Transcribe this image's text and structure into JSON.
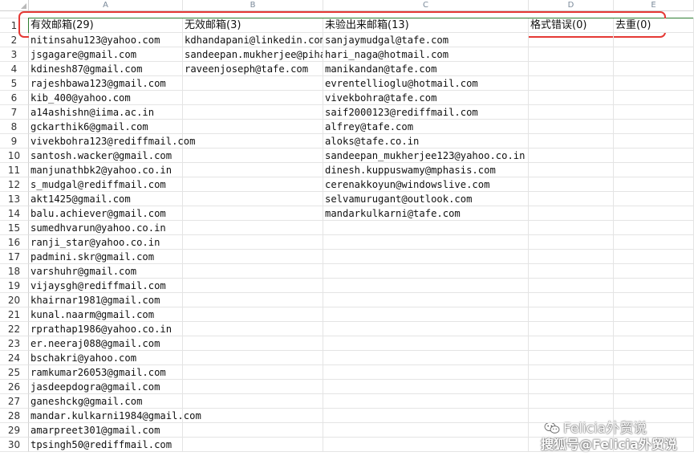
{
  "columns": [
    "A",
    "B",
    "C",
    "D",
    "E"
  ],
  "rows": [
    [
      "有效邮箱(29)",
      "无效邮箱(3)",
      "未验出来邮箱(13)",
      "格式错误(0)",
      "去重(0)"
    ],
    [
      "nitinsahu123@yahoo.com",
      "kdhandapani@linkedin.com",
      "sanjaymudgal@tafe.com",
      "",
      ""
    ],
    [
      "jsgagare@gmail.com",
      "sandeepan.mukherjee@pihari_naga@hotmail.com",
      "hari_naga@hotmail.com",
      "",
      ""
    ],
    [
      "kdinesh87@gmail.com",
      "raveenjoseph@tafe.com",
      "manikandan@tafe.com",
      "",
      ""
    ],
    [
      "rajeshbawa123@gmail.com",
      "",
      "evrentellioglu@hotmail.com",
      "",
      ""
    ],
    [
      "kib_400@yahoo.com",
      "",
      "vivekbohra@tafe.com",
      "",
      ""
    ],
    [
      "a14ashishn@iima.ac.in",
      "",
      "saif2000123@rediffmail.com",
      "",
      ""
    ],
    [
      "gckarthik6@gmail.com",
      "",
      "alfrey@tafe.com",
      "",
      ""
    ],
    [
      "vivekbohra123@rediffmail.com",
      "",
      "aloks@tafe.co.in",
      "",
      ""
    ],
    [
      "santosh.wacker@gmail.com",
      "",
      "sandeepan_mukherjee123@yahoo.co.in",
      "",
      ""
    ],
    [
      "manjunathbk2@yahoo.co.in",
      "",
      "dinesh.kuppuswamy@mphasis.com",
      "",
      ""
    ],
    [
      "s_mudgal@rediffmail.com",
      "",
      "cerenakkoyun@windowslive.com",
      "",
      ""
    ],
    [
      "akt1425@gmail.com",
      "",
      "selvamurugant@outlook.com",
      "",
      ""
    ],
    [
      "balu.achiever@gmail.com",
      "",
      "mandarkulkarni@tafe.com",
      "",
      ""
    ],
    [
      "sumedhvarun@yahoo.co.in",
      "",
      "",
      "",
      ""
    ],
    [
      "ranji_star@yahoo.co.in",
      "",
      "",
      "",
      ""
    ],
    [
      "padmini.skr@gmail.com",
      "",
      "",
      "",
      ""
    ],
    [
      "varshuhr@gmail.com",
      "",
      "",
      "",
      ""
    ],
    [
      "vijaysgh@rediffmail.com",
      "",
      "",
      "",
      ""
    ],
    [
      "khairnar1981@gmail.com",
      "",
      "",
      "",
      ""
    ],
    [
      "kunal.naarm@gmail.com",
      "",
      "",
      "",
      ""
    ],
    [
      "rprathap1986@yahoo.co.in",
      "",
      "",
      "",
      ""
    ],
    [
      "er.neeraj088@gmail.com",
      "",
      "",
      "",
      ""
    ],
    [
      "bschakri@yahoo.com",
      "",
      "",
      "",
      ""
    ],
    [
      "ramkumar26053@gmail.com",
      "",
      "",
      "",
      ""
    ],
    [
      "jasdeepdogra@gmail.com",
      "",
      "",
      "",
      ""
    ],
    [
      "ganeshckg@gmail.com",
      "",
      "",
      "",
      ""
    ],
    [
      "mandar.kulkarni1984@gmail.com",
      "",
      "",
      "",
      ""
    ],
    [
      "amarpreet301@gmail.com",
      "",
      "",
      "",
      ""
    ],
    [
      "tpsingh50@rediffmail.com",
      "",
      "",
      "",
      ""
    ]
  ],
  "row_numbers": [
    "1",
    "2",
    "3",
    "4",
    "5",
    "6",
    "7",
    "8",
    "9",
    "10",
    "11",
    "12",
    "13",
    "14",
    "15",
    "16",
    "17",
    "18",
    "19",
    "20",
    "21",
    "22",
    "23",
    "24",
    "25",
    "26",
    "27",
    "28",
    "29",
    "30"
  ],
  "watermark": {
    "line1": "Felicia外贸说",
    "line2": "搜狐号@Felicia外贸说",
    "icon": "wechat-icon"
  },
  "colors": {
    "selection_green": "#2e7d32",
    "highlight_red": "#e53935"
  }
}
